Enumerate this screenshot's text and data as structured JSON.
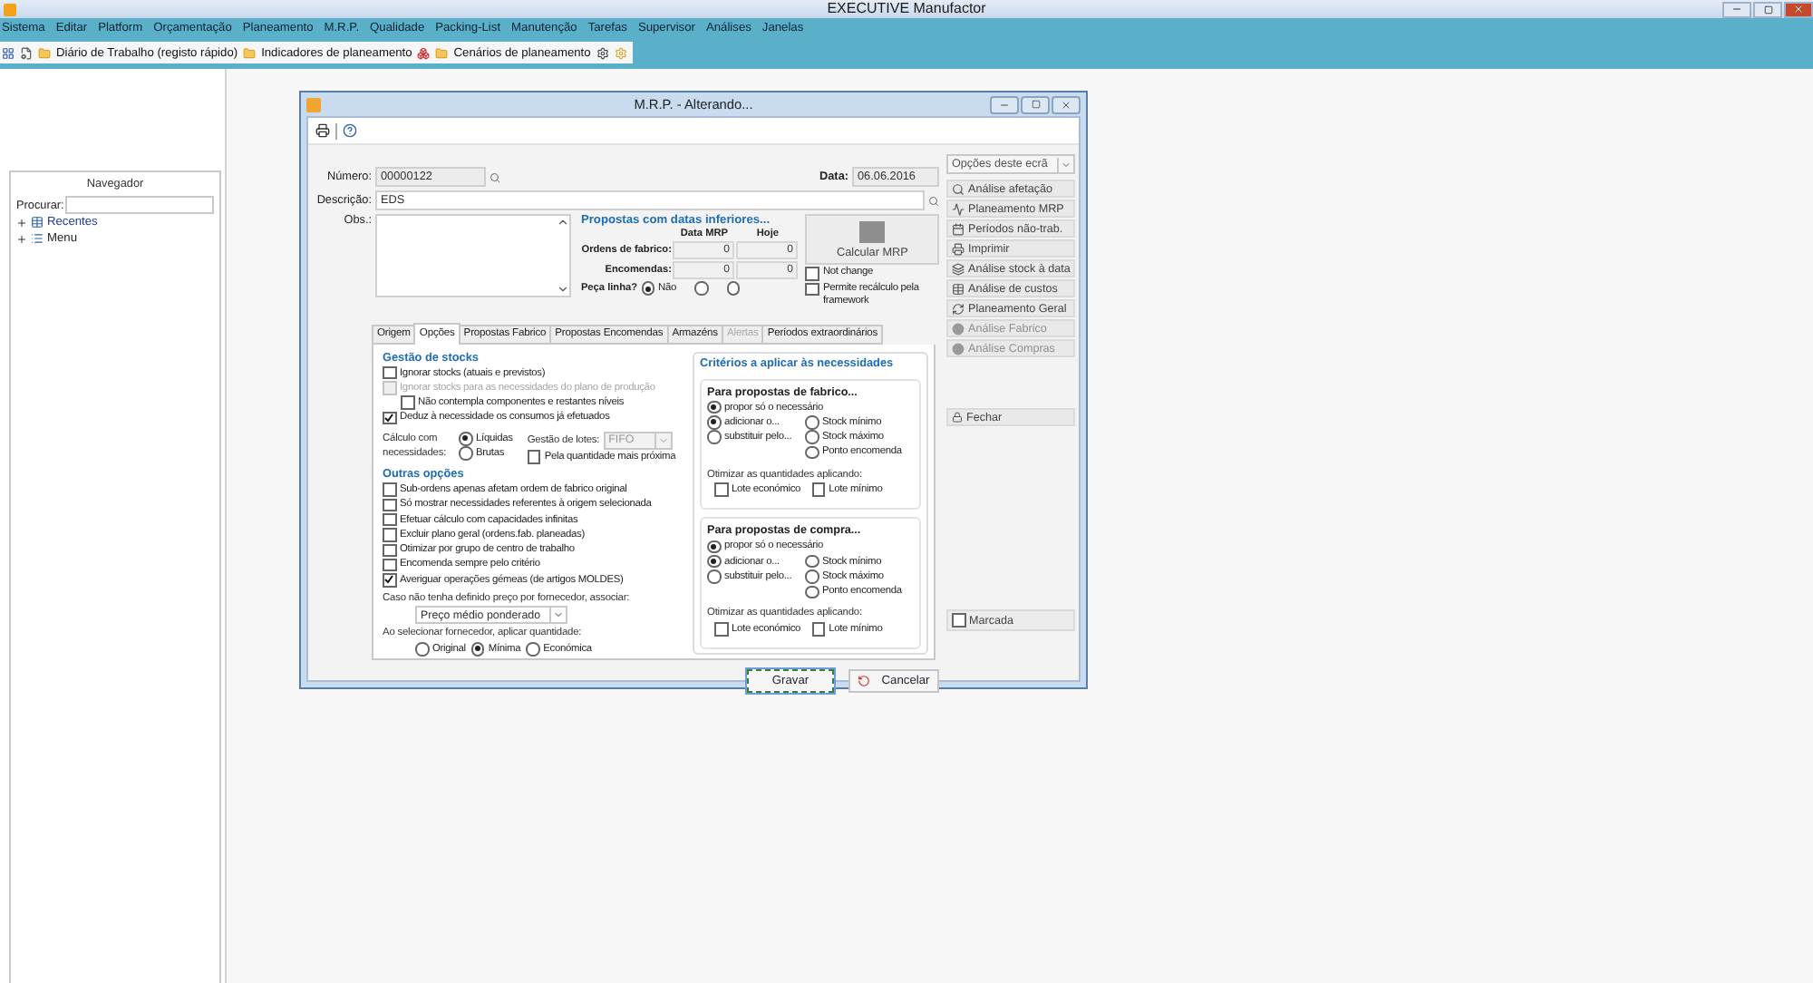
{
  "app": {
    "title": "EXECUTIVE Manufactor"
  },
  "menu": [
    "Sistema",
    "Editar",
    "Platform",
    "Orçamentação",
    "Planeamento",
    "M.R.P.",
    "Qualidade",
    "Packing-List",
    "Manutenção",
    "Tarefas",
    "Supervisor",
    "Análises",
    "Janelas"
  ],
  "shortcuts": [
    "Diário de Trabalho (registo rápido)",
    "Indicadores de planeamento",
    "Cenários de planeamento"
  ],
  "navigator": {
    "title": "Navegador",
    "search_label": "Procurar:",
    "tree": [
      {
        "label": "Recentes",
        "expanded": false,
        "selected": true
      },
      {
        "label": "Menu",
        "expanded": false,
        "selected": false
      }
    ]
  },
  "dialog": {
    "title": "M.R.P. - Alterando...",
    "number": {
      "label": "Número:",
      "value": "00000122"
    },
    "date": {
      "label": "Data:",
      "value": "06.06.2016"
    },
    "description": {
      "label": "Descrição:",
      "value": "EDS"
    },
    "obs": {
      "label": "Obs.:"
    },
    "proposals": {
      "title": "Propostas com datas inferiores...",
      "columns": [
        "Data MRP",
        "Hoje"
      ],
      "rows": [
        {
          "label": "Ordens de fabrico:",
          "values": [
            "0",
            "0"
          ]
        },
        {
          "label": "Encomendas:",
          "values": [
            "0",
            "0"
          ]
        }
      ],
      "line_piece": {
        "label": "Peça linha?",
        "options": [
          {
            "label": "Não",
            "selected": true
          },
          {
            "selected": false
          },
          {
            "selected": false
          }
        ]
      }
    },
    "calculate": {
      "label": "Calcular MRP"
    },
    "calc_checks": [
      {
        "label": "Not change",
        "checked": false
      },
      {
        "label": "Permite recálculo pela framework",
        "checked": false
      }
    ],
    "tabs": [
      {
        "label": "Origem",
        "selected": false,
        "disabled": false
      },
      {
        "label": "Opções",
        "selected": true,
        "disabled": false
      },
      {
        "label": "Propostas Fabrico",
        "selected": false,
        "disabled": false
      },
      {
        "label": "Propostas Encomendas",
        "selected": false,
        "disabled": false
      },
      {
        "label": "Armazéns",
        "selected": false,
        "disabled": false
      },
      {
        "label": "Alertas",
        "selected": false,
        "disabled": true
      },
      {
        "label": "Períodos extraordinários",
        "selected": false,
        "disabled": false
      }
    ],
    "stocks": {
      "title": "Gestão de stocks",
      "checks": [
        {
          "label": "Ignorar stocks (atuais e previstos)",
          "checked": false,
          "disabled": false
        },
        {
          "label": "Ignorar stocks para as necessidades do plano de produção",
          "checked": false,
          "disabled": true,
          "children": [
            {
              "label": "Não contempla componentes e restantes níveis",
              "checked": false,
              "disabled": false
            }
          ]
        },
        {
          "label": "Deduz à necessidade os consumos já efetuados",
          "checked": true,
          "disabled": false
        }
      ]
    },
    "calculation": {
      "label": "Cálculo com necessidades:",
      "options": [
        {
          "label": "Líquidas",
          "selected": true
        },
        {
          "label": "Brutas",
          "selected": false
        }
      ]
    },
    "lots": {
      "label": "Gestão de lotes:",
      "value": "FIFO",
      "disabled": true,
      "check": {
        "label": "Pela quantidade mais próxima",
        "checked": false
      }
    },
    "other": {
      "title": "Outras opções",
      "checks": [
        {
          "label": "Sub-ordens apenas afetam ordem de fabrico original",
          "checked": false
        },
        {
          "label": "Só mostrar necessidades referentes à origem selecionada",
          "checked": false
        },
        {
          "label": "Efetuar cálculo com capacidades infinitas",
          "checked": false
        },
        {
          "label": "Excluir plano geral (ordens.fab. planeadas)",
          "checked": false
        },
        {
          "label": "Otimizar por grupo de centro de trabalho",
          "checked": false
        },
        {
          "label": "Encomenda sempre pelo critério",
          "checked": false
        },
        {
          "label": "Averiguar operações gémeas (de artigos MOLDES)",
          "checked": true
        }
      ]
    },
    "price": {
      "label": "Caso não tenha definido preço por fornecedor, associar:",
      "value": "Preço médio ponderado"
    },
    "quantity": {
      "label": "Ao selecionar fornecedor, aplicar quantidade:",
      "options": [
        {
          "label": "Original",
          "selected": false
        },
        {
          "label": "Mínima",
          "selected": true
        },
        {
          "label": "Económica",
          "selected": false
        }
      ]
    },
    "criteria": {
      "title": "Critérios a aplicar às necessidades",
      "groups": [
        {
          "title": "Para propostas de fabrico...",
          "modes": [
            {
              "label": "propor só o necessário",
              "selected": true
            },
            {
              "label": "adicionar o...",
              "selected": true
            },
            {
              "label": "substituir pelo...",
              "selected": false
            }
          ],
          "targets": [
            {
              "label": "Stock mínimo",
              "selected": false
            },
            {
              "label": "Stock máximo",
              "selected": false
            },
            {
              "label": "Ponto encomenda",
              "selected": false
            }
          ],
          "optimize_label": "Otimizar as quantidades aplicando:",
          "optimize": [
            {
              "label": "Lote económico",
              "checked": false
            },
            {
              "label": "Lote mínimo",
              "checked": false
            }
          ]
        },
        {
          "title": "Para propostas de compra...",
          "modes": [
            {
              "label": "propor só o necessário",
              "selected": true
            },
            {
              "label": "adicionar o...",
              "selected": true
            },
            {
              "label": "substituir pelo...",
              "selected": false
            }
          ],
          "targets": [
            {
              "label": "Stock mínimo",
              "selected": false
            },
            {
              "label": "Stock máximo",
              "selected": false
            },
            {
              "label": "Ponto encomenda",
              "selected": false
            }
          ],
          "optimize_label": "Otimizar as quantidades aplicando:",
          "optimize": [
            {
              "label": "Lote económico",
              "checked": false
            },
            {
              "label": "Lote mínimo",
              "checked": false
            }
          ]
        }
      ]
    },
    "side": {
      "dropdown": "Opções deste ecrã",
      "buttons": [
        {
          "label": "Análise afetação",
          "disabled": false
        },
        {
          "label": "Planeamento MRP",
          "disabled": false
        },
        {
          "label": "Períodos não-trab.",
          "disabled": false
        },
        {
          "label": "Imprimir",
          "disabled": false
        },
        {
          "label": "Análise stock à data",
          "disabled": false
        },
        {
          "label": "Análise de custos",
          "disabled": false
        },
        {
          "label": "Planeamento Geral",
          "disabled": false
        },
        {
          "label": "Análise Fabrico",
          "disabled": true
        },
        {
          "label": "Análise Compras",
          "disabled": true
        }
      ],
      "close": "Fechar",
      "marked": {
        "label": "Marcada",
        "checked": false
      }
    },
    "footer": {
      "save": {
        "label": "Gravar",
        "focused": true
      },
      "cancel": "Cancelar"
    }
  }
}
